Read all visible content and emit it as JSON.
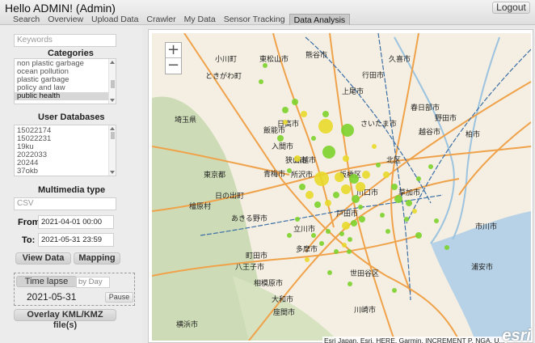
{
  "header": {
    "greeting": "Hello ADMIN! (Admin)",
    "logout": "Logout",
    "tabs": [
      "Search",
      "Overview",
      "Upload Data",
      "Crawler",
      "My Data",
      "Sensor Tracking",
      "Data Analysis"
    ],
    "active_tab": "Data Analysis"
  },
  "panel": {
    "keywords_placeholder": "Keywords",
    "categories_title": "Categories",
    "categories": [
      "non plastic garbage",
      "ocean pollution",
      "plastic garbage",
      "policy and law",
      "public health"
    ],
    "selected_category": "public health",
    "databases_title": "User Databases",
    "databases": [
      "15022174",
      "15022231",
      "19ku",
      "2022033",
      "20244",
      "37okb"
    ],
    "multimedia_title": "Multimedia type",
    "multimedia_value": "CSV",
    "from_label": "From:",
    "from_value": "2021-04-01 00:00",
    "to_label": "To:",
    "to_value": "2021-05-31 23:59",
    "view_data": "View Data",
    "mapping": "Mapping",
    "time_lapse": "Time lapse",
    "time_lapse_unit": "by Day",
    "time_lapse_date": "2021-05-31",
    "pause": "Pause",
    "overlay": "Overlay KML/KMZ file(s)"
  },
  "map": {
    "zoom_in": "+",
    "zoom_out": "−",
    "attribution": "Esri Japan, Esri, HERE, Garmin, INCREMENT P, NGA, U...",
    "logo": "esri",
    "colors": {
      "water": "#b7d2e6",
      "land": "#f4efe2",
      "forest": "#cddcb6",
      "road": "#f0a24a",
      "rail": "#3d6ea6",
      "marker_green": "#7cd12c",
      "marker_yellow": "#e8d92a"
    },
    "labels": [
      "埼玉県",
      "東京都",
      "川越市",
      "所沢市",
      "八王子市",
      "立川市",
      "青梅市",
      "日の出町",
      "檜原村",
      "相模原市",
      "座間市",
      "大和市",
      "横浜市",
      "川崎市",
      "浦安市",
      "市川市",
      "春日部市",
      "越谷市",
      "草加市",
      "上尾市",
      "熊谷市",
      "東松山市",
      "飯能市",
      "日高市",
      "入間市",
      "狭山市",
      "小川町",
      "ときがわ町",
      "野田市",
      "柏市",
      "あきる野市",
      "多摩市",
      "町田市",
      "世田谷区",
      "板橋区",
      "北区",
      "戸田市",
      "川口市",
      "さいたま市",
      "行田市",
      "久喜市"
    ]
  }
}
